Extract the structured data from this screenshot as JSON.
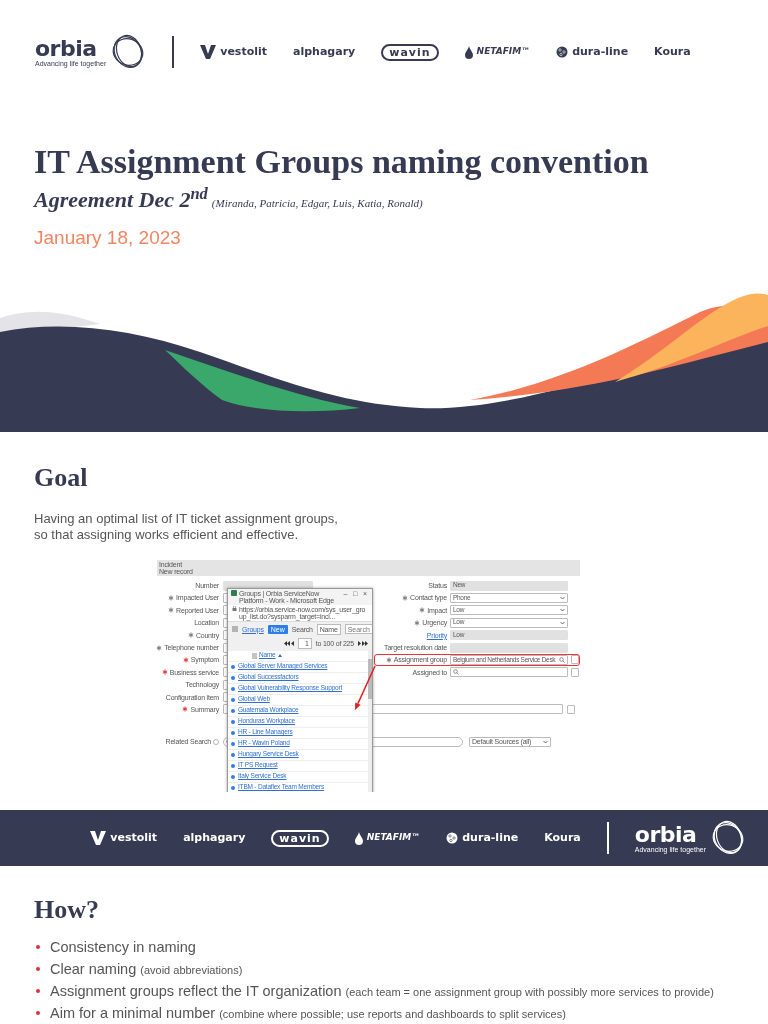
{
  "header_logos": [
    {
      "kind": "orbia",
      "name": "orbia",
      "tagline": "Advancing life together"
    },
    {
      "kind": "vestolit",
      "name": "vestolit"
    },
    {
      "kind": "plain",
      "name": "alphagary"
    },
    {
      "kind": "wavin",
      "name": "wavin"
    },
    {
      "kind": "netafim",
      "name": "NETAFIM™"
    },
    {
      "kind": "duraline",
      "name": "dura-line"
    },
    {
      "kind": "plain",
      "name": "Koura"
    }
  ],
  "title_slide": {
    "title": "IT Assignment Groups naming convention",
    "subtitle": "Agreement Dec 2$^{nd}$",
    "attendees": "(Miranda, Patricia, Edgar, Luis, Katia, Ronald)",
    "date": "January 18, 2023"
  },
  "goal_slide": {
    "heading": "Goal",
    "text": "Having an optimal list of IT ticket assignment groups,\nso that assigning works efficient and effective.",
    "screenshot": {
      "header": [
        "Incident",
        "New record"
      ],
      "rows": [
        {
          "left": {
            "label": "Number",
            "kind": "readonly",
            "required": false,
            "mandatory": false
          },
          "right": {
            "label": "Status",
            "kind": "readonly",
            "value": "New",
            "required": false,
            "mandatory": false,
            "link": false,
            "highlighted": false
          }
        },
        {
          "left": {
            "label": "Impacted User",
            "kind": "text",
            "required": false,
            "mandatory": true
          },
          "right": {
            "label": "Contact type",
            "kind": "select",
            "value": "Phone",
            "required": false,
            "mandatory": true,
            "link": false,
            "highlighted": false
          }
        },
        {
          "left": {
            "label": "Reported User",
            "kind": "text",
            "required": false,
            "mandatory": true
          },
          "right": {
            "label": "Impact",
            "kind": "select",
            "value": "Low",
            "required": false,
            "mandatory": true,
            "link": false,
            "highlighted": false
          }
        },
        {
          "left": {
            "label": "Location",
            "kind": "text",
            "required": false,
            "mandatory": false
          },
          "right": {
            "label": "Urgency",
            "kind": "select",
            "value": "Low",
            "required": false,
            "mandatory": true,
            "link": false,
            "highlighted": false
          }
        },
        {
          "left": {
            "label": "Country",
            "kind": "text",
            "required": false,
            "mandatory": true
          },
          "right": {
            "label": "Priority",
            "kind": "readonly",
            "value": "Low",
            "required": false,
            "mandatory": false,
            "link": true,
            "highlighted": false
          }
        },
        {
          "left": {
            "label": "Telephone number",
            "kind": "text",
            "required": false,
            "mandatory": true
          },
          "right": {
            "label": "Target resolution date",
            "kind": "readonly",
            "required": false,
            "mandatory": false,
            "link": false,
            "highlighted": false
          }
        },
        {
          "left": {
            "label": "Symptom",
            "kind": "text",
            "required": true,
            "mandatory": false
          },
          "right": {
            "label": "Assignment group",
            "kind": "lookup",
            "value": "Belgium and Netherlands Service Desk",
            "required": false,
            "mandatory": true,
            "link": false,
            "highlighted": true
          }
        },
        {
          "left": {
            "label": "Business service",
            "kind": "text",
            "required": true,
            "mandatory": false
          },
          "right": {
            "label": "Assigned to",
            "kind": "lookup",
            "required": false,
            "mandatory": false,
            "link": false,
            "highlighted": false
          }
        },
        {
          "left": {
            "label": "Technology",
            "kind": "text",
            "required": false,
            "mandatory": false
          }
        },
        {
          "left": {
            "label": "Configuration item",
            "kind": "text",
            "required": false,
            "mandatory": false
          }
        },
        {
          "left": {
            "label": "Summary",
            "kind": "wide",
            "required": true,
            "mandatory": false
          }
        }
      ],
      "related_search": {
        "label": "Related Search",
        "sources": "Default Sources (all)"
      },
      "popup": {
        "title": "Groups | Orbia ServiceNow Platform - Work - Microsoft Edge",
        "window_controls": [
          "–",
          "□",
          "×"
        ],
        "url": "https://orbia.service-now.com/sys_user_group_list.do?sysparm_target=inci...",
        "list_link": "Groups",
        "new_button": "New",
        "search_label": "Search",
        "search_by": "Name",
        "search_placeholder": "Search",
        "page_input": "1",
        "page_range": "to 100 of 225",
        "column": "Name",
        "items": [
          "Global Server Managed Services",
          "Global Successfactors",
          "Global Vulnerability Response Support",
          "Global Web",
          "Guatemala Workplace",
          "Honduras Workplace",
          "HR - Line Managers",
          "HR - Wavin Poland",
          "Hungary Service Desk",
          "IT PS Request",
          "Italy Service Desk",
          "ITBM - Dataflex Team Members"
        ]
      }
    }
  },
  "footer_logos": [
    {
      "kind": "vestolit",
      "name": "vestolit"
    },
    {
      "kind": "plain",
      "name": "alphagary"
    },
    {
      "kind": "wavin",
      "name": "wavin"
    },
    {
      "kind": "netafim",
      "name": "NETAFIM™"
    },
    {
      "kind": "duraline",
      "name": "dura-line"
    },
    {
      "kind": "plain",
      "name": "Koura"
    },
    {
      "kind": "orbia",
      "name": "orbia",
      "tagline": "Advancing life together"
    }
  ],
  "how_slide": {
    "heading": "How?",
    "bullets": [
      {
        "text": "Consistency in naming"
      },
      {
        "text": "Clear naming",
        "note": "(avoid abbreviations)"
      },
      {
        "text": "Assignment groups reflect the IT organization",
        "note": "(each team = one assignment group with possibly more services to provide)"
      },
      {
        "text": "Aim for a minimal number",
        "note": "(combine where possible; use reports and dashboards to split services)"
      }
    ]
  }
}
